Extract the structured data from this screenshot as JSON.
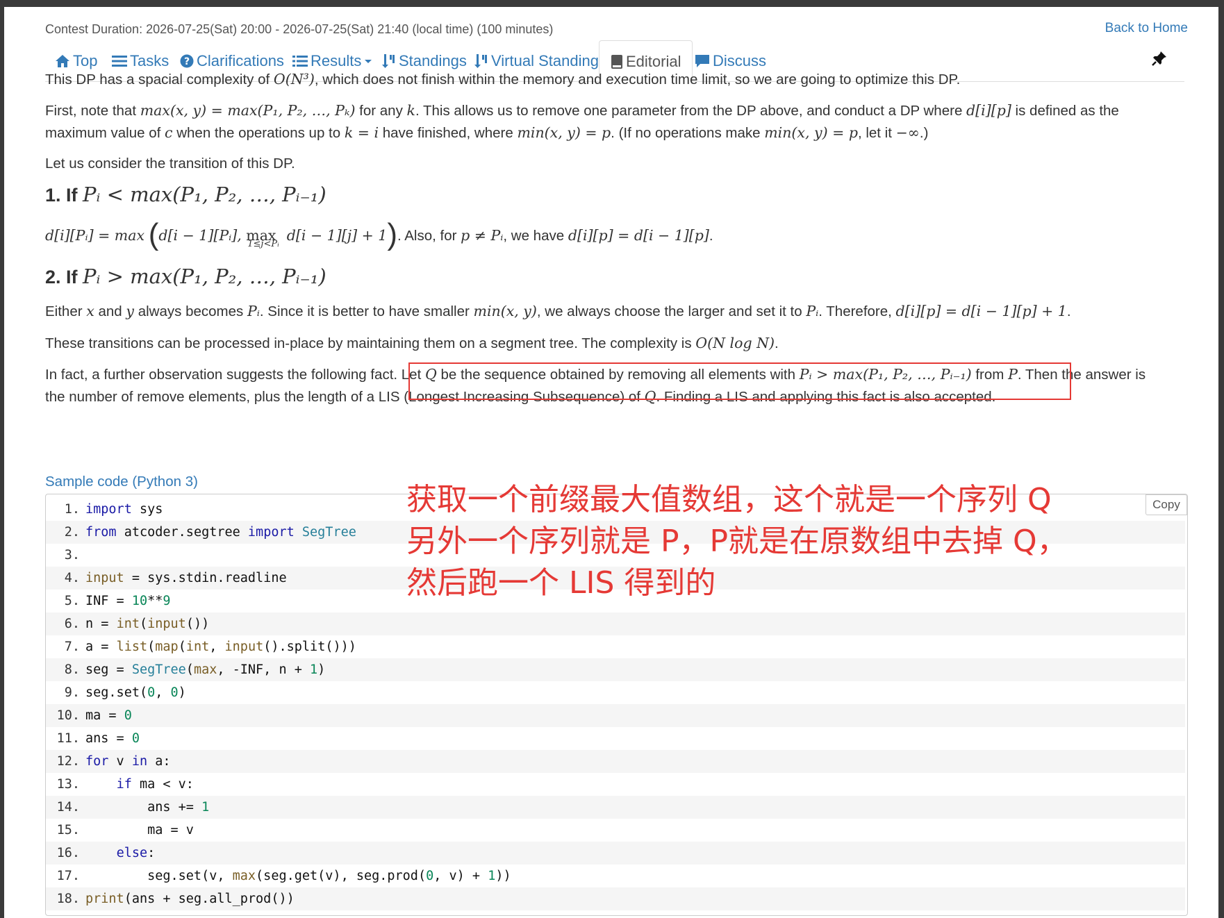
{
  "header": {
    "contest_duration": "Contest Duration: 2026-07-25(Sat) 20:00 - 2026-07-25(Sat) 21:40 (local time) (100 minutes)",
    "back_home": "Back to Home"
  },
  "nav": {
    "top": "Top",
    "tasks": "Tasks",
    "clarifications": "Clarifications",
    "results": "Results",
    "standings": "Standings",
    "virtual_standings": "Virtual Standings",
    "editorial": "Editorial",
    "discuss": "Discuss",
    "active_tab": "Editorial"
  },
  "editorial": {
    "p0": [
      "This DP has a spacial complexity of ",
      "O(N³)",
      ", which does not finish within the memory and execution time limit, so we are going to optimize this DP."
    ],
    "p1a": [
      "First, note that ",
      "max(x, y) = max(P₁, P₂, …, Pₖ)",
      " for any ",
      "k",
      ". This allows us to remove one parameter from the DP above, and conduct a DP where ",
      "d[i][p]",
      " is defined as the"
    ],
    "p1b": [
      "maximum value of ",
      "c",
      " when the operations up to ",
      "k = i",
      " have finished, where ",
      "min(x, y) = p",
      ". (If no operations make ",
      "min(x, y) = p",
      ", let it ",
      "−∞",
      ".)"
    ],
    "p2": "Let us consider the transition of this DP.",
    "h1": [
      "1. If ",
      "Pᵢ < max(P₁, P₂, …, Pᵢ₋₁)"
    ],
    "eq1": [
      "d[i][Pᵢ] = max",
      "d[i − 1][Pᵢ], ",
      "max",
      "1≤j<Pᵢ",
      " d[i − 1][j] + 1",
      ". Also, for ",
      "p ≠ Pᵢ",
      ", we have ",
      "d[i][p] = d[i − 1][p]",
      "."
    ],
    "h2": [
      "2. If ",
      "Pᵢ > max(P₁, P₂, …, Pᵢ₋₁)"
    ],
    "p3": [
      "Either ",
      "x",
      " and ",
      "y",
      " always becomes ",
      "Pᵢ",
      ". Since it is better to have smaller ",
      "min(x, y)",
      ", we always choose the larger and set it to ",
      "Pᵢ",
      ". Therefore, ",
      "d[i][p] = d[i − 1][p] + 1",
      "."
    ],
    "p4": [
      "These transitions can be processed in-place by maintaining them on a segment tree. The complexity is ",
      "O(N log N)",
      "."
    ],
    "p5a": [
      "In fact, a further observation suggests the following fact. ",
      "Let ",
      "Q",
      " be the sequence obtained by removing all elements with ",
      "Pᵢ > max(P₁, P₂, …, Pᵢ₋₁)",
      " from ",
      "P",
      ". Then the answer is"
    ],
    "p5b": [
      "the number of remove elements, plus the length of a LIS (Longest Increasing Subsequence) of ",
      "Q",
      ". Finding a LIS and applying this fact is also accepted."
    ],
    "sample_link": "Sample code (Python 3)"
  },
  "code": {
    "copy_label": "Copy",
    "lines": [
      "import sys",
      "from atcoder.segtree import SegTree",
      "",
      "input = sys.stdin.readline",
      "INF = 10**9",
      "n = int(input())",
      "a = list(map(int, input().split()))",
      "seg = SegTree(max, -INF, n + 1)",
      "seg.set(0, 0)",
      "ma = 0",
      "ans = 0",
      "for v in a:",
      "    if ma < v:",
      "        ans += 1",
      "        ma = v",
      "    else:",
      "        seg.set(v, max(seg.get(v), seg.prod(0, v) + 1))",
      "print(ans + seg.all_prod())"
    ]
  },
  "annotation": {
    "color": "#e53935",
    "lines": [
      "获取一个前缀最大值数组，这个就是一个序列 Q",
      "另外一个序列就是 P，P就是在原数组中去掉 Q，",
      "然后跑一个 LIS 得到的"
    ]
  },
  "colors": {
    "link": "#337ab7",
    "text": "#333333",
    "highlight_box": "#e53935"
  }
}
